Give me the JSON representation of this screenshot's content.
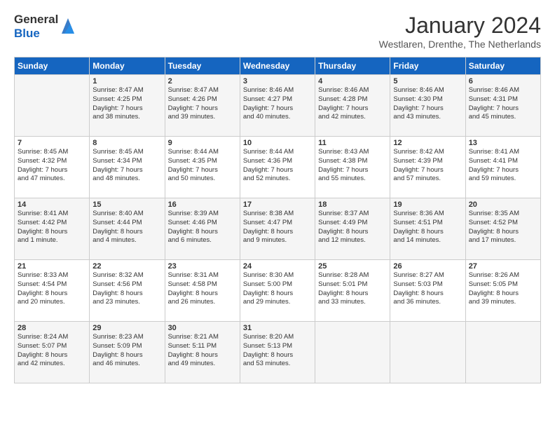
{
  "header": {
    "logo_general": "General",
    "logo_blue": "Blue",
    "month_title": "January 2024",
    "subtitle": "Westlaren, Drenthe, The Netherlands"
  },
  "days_of_week": [
    "Sunday",
    "Monday",
    "Tuesday",
    "Wednesday",
    "Thursday",
    "Friday",
    "Saturday"
  ],
  "weeks": [
    [
      {
        "day": "",
        "info": ""
      },
      {
        "day": "1",
        "info": "Sunrise: 8:47 AM\nSunset: 4:25 PM\nDaylight: 7 hours\nand 38 minutes."
      },
      {
        "day": "2",
        "info": "Sunrise: 8:47 AM\nSunset: 4:26 PM\nDaylight: 7 hours\nand 39 minutes."
      },
      {
        "day": "3",
        "info": "Sunrise: 8:46 AM\nSunset: 4:27 PM\nDaylight: 7 hours\nand 40 minutes."
      },
      {
        "day": "4",
        "info": "Sunrise: 8:46 AM\nSunset: 4:28 PM\nDaylight: 7 hours\nand 42 minutes."
      },
      {
        "day": "5",
        "info": "Sunrise: 8:46 AM\nSunset: 4:30 PM\nDaylight: 7 hours\nand 43 minutes."
      },
      {
        "day": "6",
        "info": "Sunrise: 8:46 AM\nSunset: 4:31 PM\nDaylight: 7 hours\nand 45 minutes."
      }
    ],
    [
      {
        "day": "7",
        "info": "Sunrise: 8:45 AM\nSunset: 4:32 PM\nDaylight: 7 hours\nand 47 minutes."
      },
      {
        "day": "8",
        "info": "Sunrise: 8:45 AM\nSunset: 4:34 PM\nDaylight: 7 hours\nand 48 minutes."
      },
      {
        "day": "9",
        "info": "Sunrise: 8:44 AM\nSunset: 4:35 PM\nDaylight: 7 hours\nand 50 minutes."
      },
      {
        "day": "10",
        "info": "Sunrise: 8:44 AM\nSunset: 4:36 PM\nDaylight: 7 hours\nand 52 minutes."
      },
      {
        "day": "11",
        "info": "Sunrise: 8:43 AM\nSunset: 4:38 PM\nDaylight: 7 hours\nand 55 minutes."
      },
      {
        "day": "12",
        "info": "Sunrise: 8:42 AM\nSunset: 4:39 PM\nDaylight: 7 hours\nand 57 minutes."
      },
      {
        "day": "13",
        "info": "Sunrise: 8:41 AM\nSunset: 4:41 PM\nDaylight: 7 hours\nand 59 minutes."
      }
    ],
    [
      {
        "day": "14",
        "info": "Sunrise: 8:41 AM\nSunset: 4:42 PM\nDaylight: 8 hours\nand 1 minute."
      },
      {
        "day": "15",
        "info": "Sunrise: 8:40 AM\nSunset: 4:44 PM\nDaylight: 8 hours\nand 4 minutes."
      },
      {
        "day": "16",
        "info": "Sunrise: 8:39 AM\nSunset: 4:46 PM\nDaylight: 8 hours\nand 6 minutes."
      },
      {
        "day": "17",
        "info": "Sunrise: 8:38 AM\nSunset: 4:47 PM\nDaylight: 8 hours\nand 9 minutes."
      },
      {
        "day": "18",
        "info": "Sunrise: 8:37 AM\nSunset: 4:49 PM\nDaylight: 8 hours\nand 12 minutes."
      },
      {
        "day": "19",
        "info": "Sunrise: 8:36 AM\nSunset: 4:51 PM\nDaylight: 8 hours\nand 14 minutes."
      },
      {
        "day": "20",
        "info": "Sunrise: 8:35 AM\nSunset: 4:52 PM\nDaylight: 8 hours\nand 17 minutes."
      }
    ],
    [
      {
        "day": "21",
        "info": "Sunrise: 8:33 AM\nSunset: 4:54 PM\nDaylight: 8 hours\nand 20 minutes."
      },
      {
        "day": "22",
        "info": "Sunrise: 8:32 AM\nSunset: 4:56 PM\nDaylight: 8 hours\nand 23 minutes."
      },
      {
        "day": "23",
        "info": "Sunrise: 8:31 AM\nSunset: 4:58 PM\nDaylight: 8 hours\nand 26 minutes."
      },
      {
        "day": "24",
        "info": "Sunrise: 8:30 AM\nSunset: 5:00 PM\nDaylight: 8 hours\nand 29 minutes."
      },
      {
        "day": "25",
        "info": "Sunrise: 8:28 AM\nSunset: 5:01 PM\nDaylight: 8 hours\nand 33 minutes."
      },
      {
        "day": "26",
        "info": "Sunrise: 8:27 AM\nSunset: 5:03 PM\nDaylight: 8 hours\nand 36 minutes."
      },
      {
        "day": "27",
        "info": "Sunrise: 8:26 AM\nSunset: 5:05 PM\nDaylight: 8 hours\nand 39 minutes."
      }
    ],
    [
      {
        "day": "28",
        "info": "Sunrise: 8:24 AM\nSunset: 5:07 PM\nDaylight: 8 hours\nand 42 minutes."
      },
      {
        "day": "29",
        "info": "Sunrise: 8:23 AM\nSunset: 5:09 PM\nDaylight: 8 hours\nand 46 minutes."
      },
      {
        "day": "30",
        "info": "Sunrise: 8:21 AM\nSunset: 5:11 PM\nDaylight: 8 hours\nand 49 minutes."
      },
      {
        "day": "31",
        "info": "Sunrise: 8:20 AM\nSunset: 5:13 PM\nDaylight: 8 hours\nand 53 minutes."
      },
      {
        "day": "",
        "info": ""
      },
      {
        "day": "",
        "info": ""
      },
      {
        "day": "",
        "info": ""
      }
    ]
  ]
}
